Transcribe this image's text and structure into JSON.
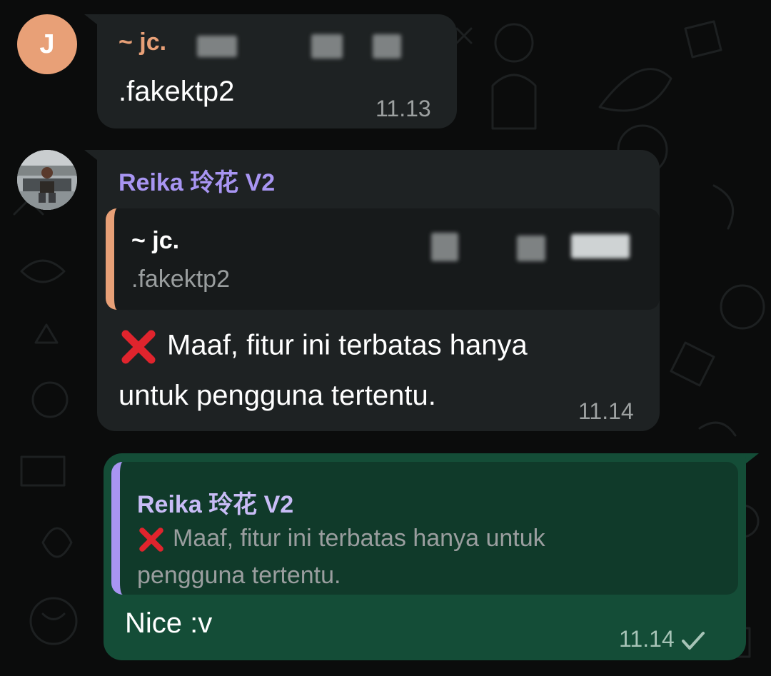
{
  "messages": [
    {
      "sender": "~ jc.",
      "avatar_initial": "J",
      "text": ".fakektp2",
      "time": "11.13"
    },
    {
      "sender": "Reika 玲花 V2",
      "quote": {
        "sender": "~ jc.",
        "text": ".fakektp2"
      },
      "text_line1": "Maaf, fitur ini terbatas hanya",
      "text_line2": "untuk pengguna tertentu.",
      "time": "11.14"
    },
    {
      "quote": {
        "sender": "Reika 玲花 V2",
        "text_line1": "Maaf, fitur ini terbatas hanya untuk",
        "text_line2": "pengguna tertentu."
      },
      "text": "Nice :v",
      "time": "11.14"
    }
  ],
  "colors": {
    "jc_accent": "#e8a077",
    "reika_accent": "#a895f2",
    "incoming_bubble": "#1e2223",
    "outgoing_bubble": "#144d37",
    "cross_mark": "#e0242d"
  },
  "icons": [
    "cross-mark-icon",
    "single-check-icon",
    "avatar-photo"
  ]
}
